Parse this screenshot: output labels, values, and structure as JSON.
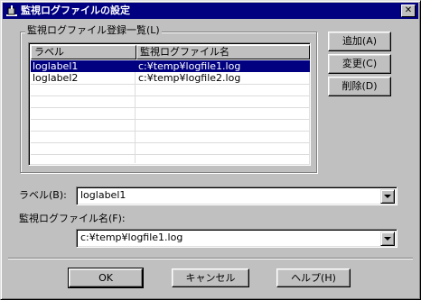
{
  "window": {
    "title": "監視ログファイルの設定",
    "close_label": "✕"
  },
  "group": {
    "legend": "監視ログファイル登録一覧(L)"
  },
  "list": {
    "columns": [
      "ラベル",
      "監視ログファイル名"
    ],
    "rows": [
      {
        "label": "loglabel1",
        "file": "c:¥temp¥logfile1.log",
        "selected": true
      },
      {
        "label": "loglabel2",
        "file": "c:¥temp¥logfile2.log",
        "selected": false
      }
    ]
  },
  "side_buttons": {
    "add": "追加(A)",
    "change": "変更(C)",
    "delete": "削除(D)"
  },
  "form": {
    "label_caption": "ラベル(B):",
    "label_value": "loglabel1",
    "file_caption": "監視ログファイル名(F):",
    "file_value": "c:¥temp¥logfile1.log"
  },
  "bottom_buttons": {
    "ok": "OK",
    "cancel": "キャンセル",
    "help": "ヘルプ(H)"
  },
  "colors": {
    "face": "#c0c0c0",
    "titlebar": "#000080",
    "selection": "#000080"
  }
}
